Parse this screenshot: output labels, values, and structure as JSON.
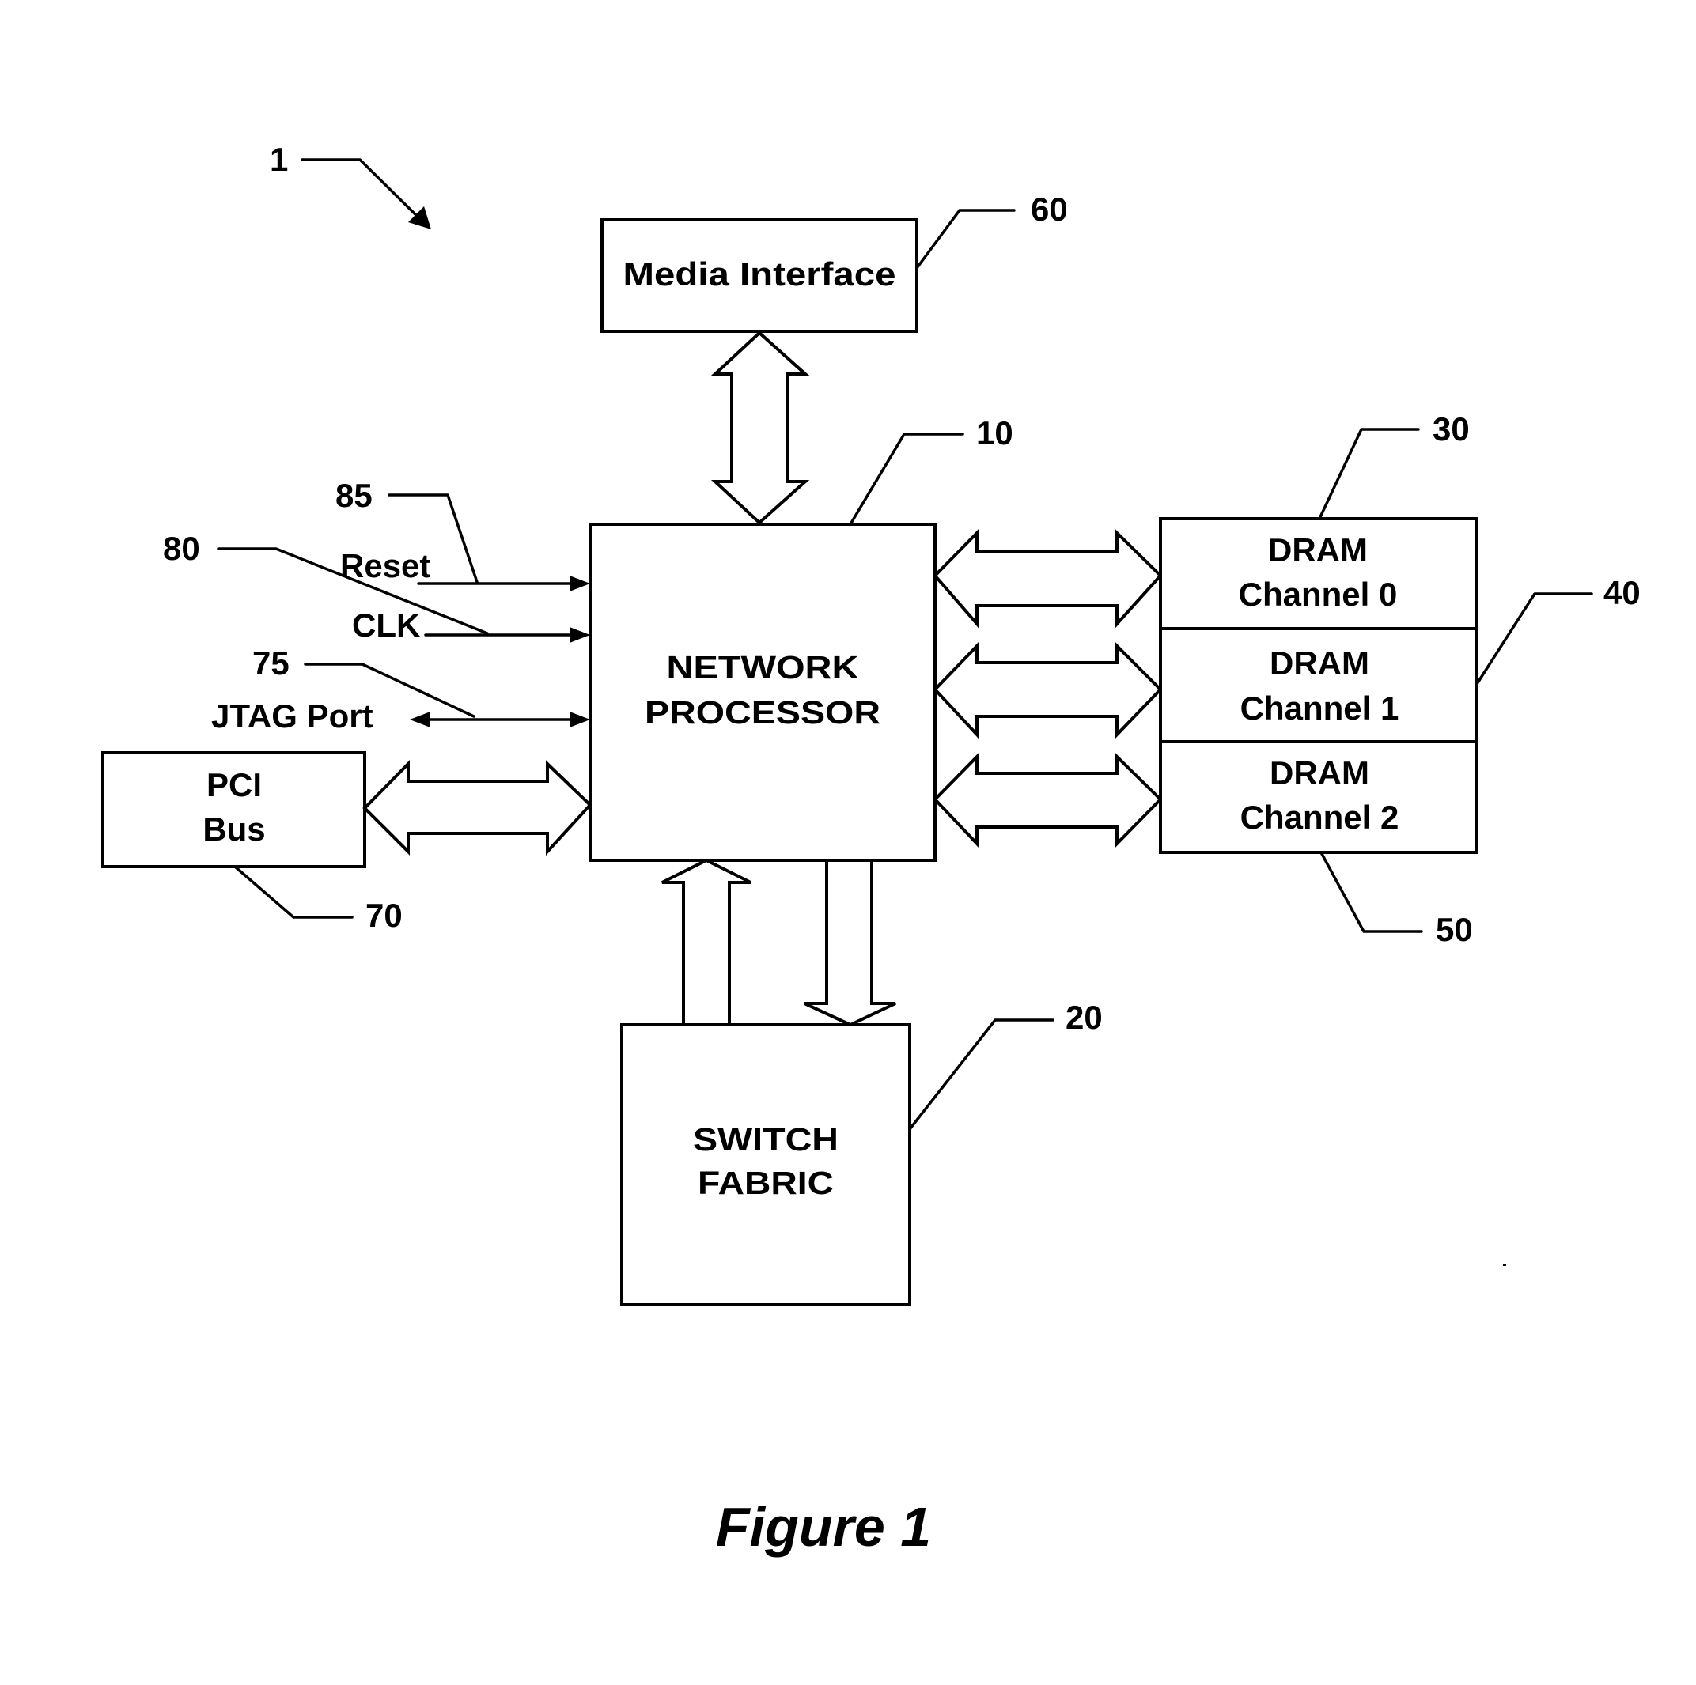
{
  "figure": {
    "caption": "Figure 1",
    "system_ref": "1"
  },
  "blocks": {
    "media_interface": {
      "label": "Media Interface",
      "ref": "60"
    },
    "network_processor": {
      "line1": "NETWORK",
      "line2": "PROCESSOR",
      "ref": "10"
    },
    "switch_fabric": {
      "line1": "SWITCH",
      "line2": "FABRIC",
      "ref": "20"
    },
    "pci_bus": {
      "line1": "PCI",
      "line2": "Bus",
      "ref": "70"
    },
    "dram": [
      {
        "line1": "DRAM",
        "line2": "Channel 0",
        "ref": "30"
      },
      {
        "line1": "DRAM",
        "line2": "Channel 1",
        "ref": "40"
      },
      {
        "line1": "DRAM",
        "line2": "Channel 2",
        "ref": "50"
      }
    ]
  },
  "signals": {
    "reset": {
      "label": "Reset",
      "ref": "85"
    },
    "clk": {
      "label": "CLK",
      "ref": "80"
    },
    "jtag": {
      "label": "JTAG Port",
      "ref": "75"
    }
  }
}
